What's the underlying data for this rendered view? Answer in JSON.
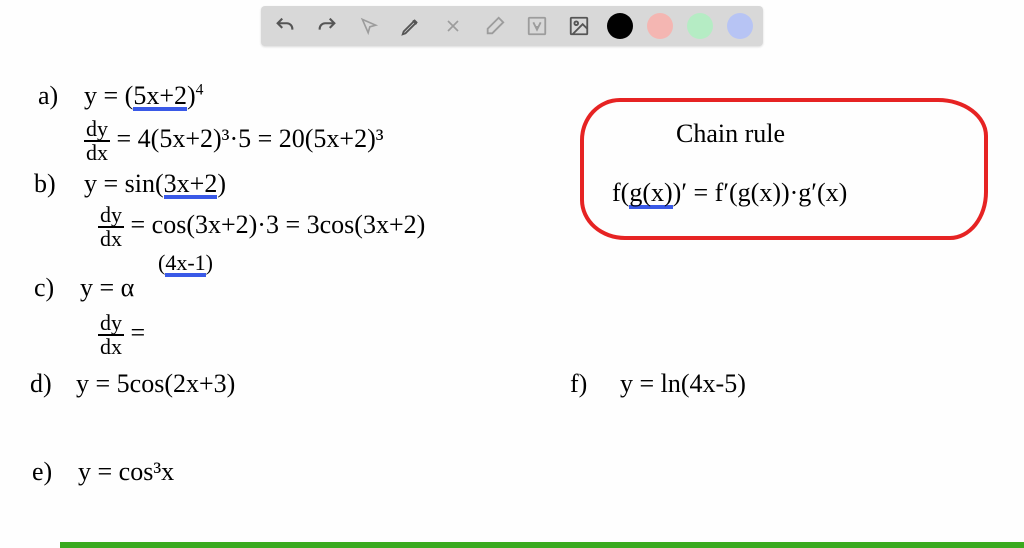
{
  "toolbar": {
    "icons": {
      "undo": "undo-icon",
      "redo": "redo-icon",
      "pointer": "pointer-icon",
      "pen": "pen-icon",
      "tools": "tools-icon",
      "eraser": "eraser-icon",
      "text": "text-icon",
      "image": "image-icon"
    },
    "colors": {
      "black": "#010101",
      "pink": "#f4b6b2",
      "green": "#b5ecc4",
      "blue": "#b7c4f4"
    }
  },
  "problems": {
    "a": {
      "label": "a)",
      "eq_pre": "y = (",
      "eq_inner": "5x+2",
      "eq_post": ")",
      "eq_exp": "4",
      "deriv": "= 4(5x+2)³·5 = 20(5x+2)³"
    },
    "b": {
      "label": "b)",
      "eq_pre": "y = sin(",
      "eq_inner": "3x+2",
      "eq_post": ")",
      "deriv": "= cos(3x+2)·3 = 3cos(3x+2)"
    },
    "c": {
      "label": "c)",
      "eq_pre": "y = α",
      "exp_pre": "(",
      "exp_inner": "4x-1",
      "exp_post": ")",
      "deriv": "="
    },
    "d": {
      "label": "d)",
      "eq": "y = 5cos(2x+3)"
    },
    "e": {
      "label": "e)",
      "eq": "y = cos³x"
    },
    "f": {
      "label": "f)",
      "eq": "y = ln(4x-5)"
    }
  },
  "rule": {
    "title": "Chain rule",
    "formula_pre": "f(",
    "formula_inner": "g(x)",
    "formula_post": ")′ = f′(g(x))·g′(x)"
  },
  "dy": "dy",
  "dx": "dx"
}
